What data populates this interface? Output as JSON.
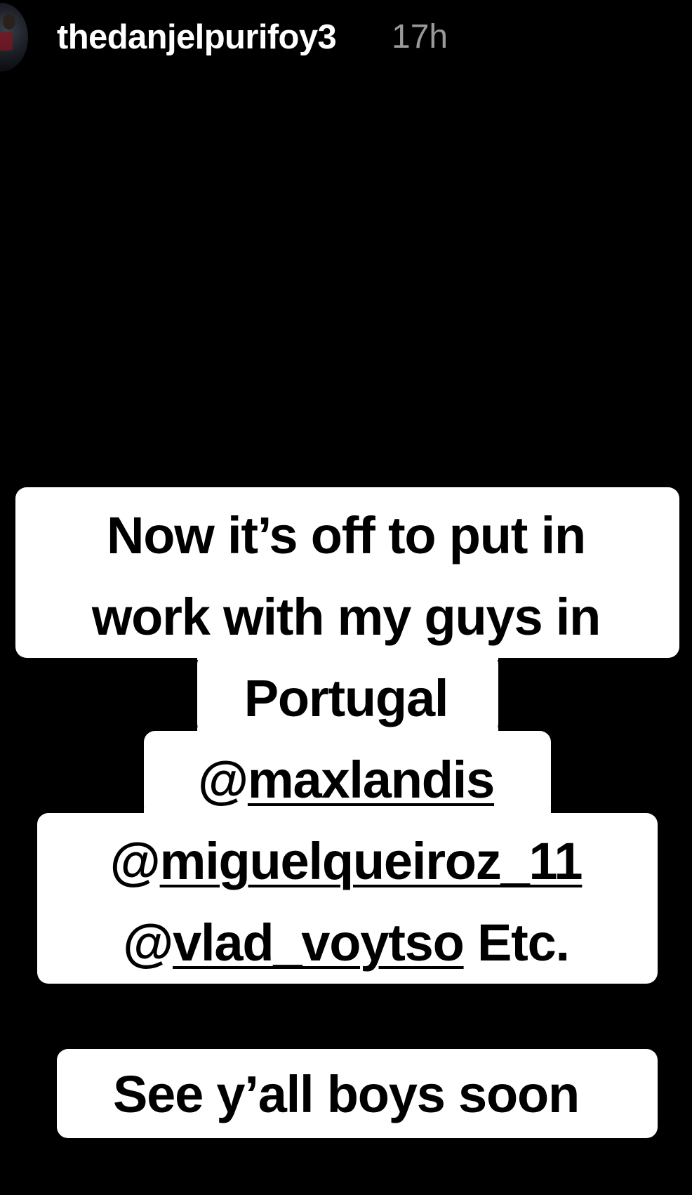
{
  "story": {
    "username": "thedanjelpurifoy3",
    "timestamp": "17h",
    "avatar_icon": "profile-avatar"
  },
  "caption": {
    "line1": "Now it’s off to put in",
    "line2": "work with my guys in",
    "line3": "Portugal",
    "line4_at": "@",
    "line4_handle": "maxlandis",
    "line5_at": "@",
    "line5_handle": "miguelqueiroz_11",
    "line6_at": "@",
    "line6_handle": "vlad_voytso",
    "line6_suffix": " Etc."
  },
  "footer_caption": {
    "text": "See y’all boys soon"
  },
  "colors": {
    "background": "#000000",
    "text_box": "#ffffff",
    "text": "#000000",
    "timestamp": "#9a9a9a"
  }
}
